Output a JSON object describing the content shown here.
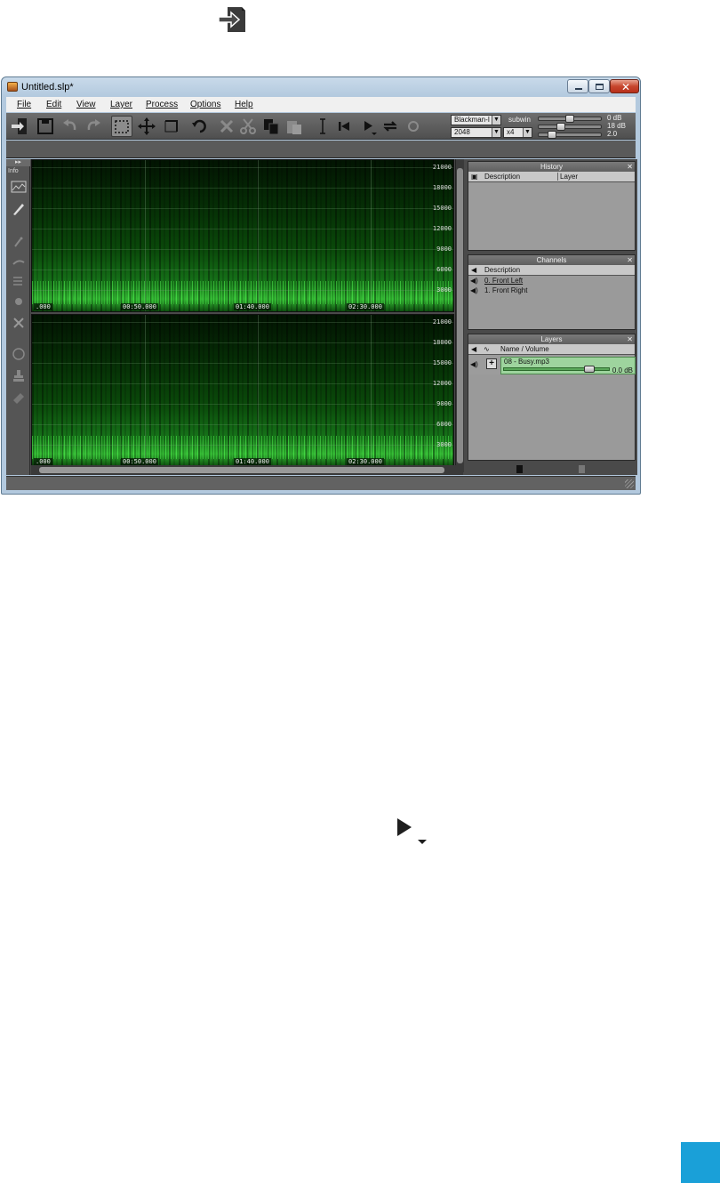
{
  "window": {
    "title": "Untitled.slp*",
    "controls": [
      "minimize",
      "maximize",
      "close"
    ]
  },
  "menu": [
    "File",
    "Edit",
    "View",
    "Layer",
    "Process",
    "Options",
    "Help"
  ],
  "toolbar": {
    "window_fn": "Blackman-I",
    "fft_size": "2048",
    "overlap": "x4",
    "subwin_label": "subwin",
    "gain_top": "0 dB",
    "gain_range": "18 dB",
    "gamma": "2.0",
    "gain_top_value_db": 0,
    "range_value_db": 18,
    "gamma_value": 2.0
  },
  "left_tools": {
    "info_label": "Info"
  },
  "spectrogram": {
    "freq_ticks": [
      "21000",
      "18000",
      "15000",
      "12000",
      "9000",
      "6000",
      "3000"
    ],
    "time_ticks": [
      ".000",
      "00:50.000",
      "01:40.000",
      "02:30.000"
    ],
    "channels_shown": 2
  },
  "history": {
    "title": "History",
    "columns": [
      "Description",
      "Layer"
    ]
  },
  "channels": {
    "title": "Channels",
    "column": "Description",
    "items": [
      "0. Front Left",
      "1. Front Right"
    ]
  },
  "layers": {
    "title": "Layers",
    "column": "Name / Volume",
    "items": [
      {
        "name": "08 - Busy.mp3",
        "volume": "0.0  dB"
      }
    ]
  },
  "colors": {
    "accent_blue": "#1aa0d8",
    "spectrogram_green": "#33b733",
    "layer_highlight": "#9ed49e",
    "close_red": "#c7462d"
  }
}
